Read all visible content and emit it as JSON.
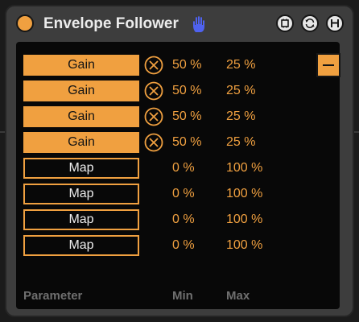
{
  "device": {
    "title": "Envelope Follower",
    "icons": {
      "power": "power-icon",
      "hand": "hand-icon",
      "freeze": "freeze-icon",
      "refresh": "refresh-icon",
      "save": "save-icon"
    },
    "accent_color": "#f0a040",
    "hand_color": "#4f62f0"
  },
  "mappings": [
    {
      "label": "Gain",
      "min": "50 %",
      "max": "25 %",
      "mapped": true
    },
    {
      "label": "Gain",
      "min": "50 %",
      "max": "25 %",
      "mapped": true
    },
    {
      "label": "Gain",
      "min": "50 %",
      "max": "25 %",
      "mapped": true
    },
    {
      "label": "Gain",
      "min": "50 %",
      "max": "25 %",
      "mapped": true
    },
    {
      "label": "Map",
      "min": "0 %",
      "max": "100 %",
      "mapped": false
    },
    {
      "label": "Map",
      "min": "0 %",
      "max": "100 %",
      "mapped": false
    },
    {
      "label": "Map",
      "min": "0 %",
      "max": "100 %",
      "mapped": false
    },
    {
      "label": "Map",
      "min": "0 %",
      "max": "100 %",
      "mapped": false
    }
  ],
  "columns": {
    "parameter": "Parameter",
    "min": "Min",
    "max": "Max"
  },
  "collapse_button": "minus-icon"
}
